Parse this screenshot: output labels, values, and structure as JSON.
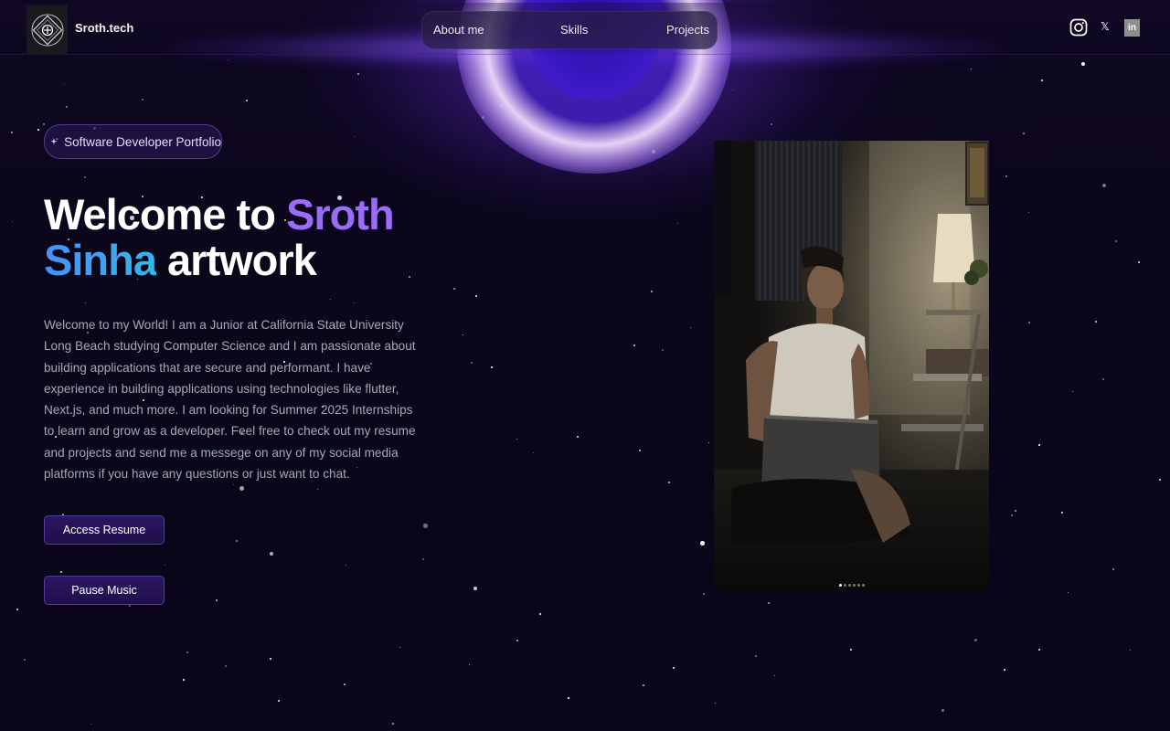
{
  "header": {
    "brand": "Sroth.tech",
    "nav": [
      {
        "label": "About me"
      },
      {
        "label": "Skills"
      },
      {
        "label": "Projects"
      }
    ],
    "social": [
      {
        "icon": "instagram-icon"
      },
      {
        "icon": "x-icon",
        "label": "𝕏"
      },
      {
        "icon": "linkedin-icon",
        "label": "in"
      }
    ]
  },
  "hero": {
    "badge": "Software Developer Portfolio",
    "headline": {
      "part1": "Welcome to",
      "part2": "Sroth",
      "part3": "Sinha",
      "part4": "artwork"
    },
    "intro": "Welcome to my World! I am a Junior at California State University Long Beach studying Computer Science and I am passionate about building applications that are secure and performant. I have experience in building applications using technologies like flutter, Next.js, and much more. I am looking for Summer 2025 Internships to learn and grow as a developer. Feel free to check out my resume and projects and send me a messege on any of my social media platforms if you have any questions or just want to chat.",
    "buttons": {
      "resume": "Access Resume",
      "music": "Pause Music"
    }
  },
  "carousel": {
    "slides": 6,
    "active": 1
  },
  "colors": {
    "accent_purple": "#9b6cf7",
    "accent_blue": "#4a8ef6",
    "background": "#0a0618"
  }
}
